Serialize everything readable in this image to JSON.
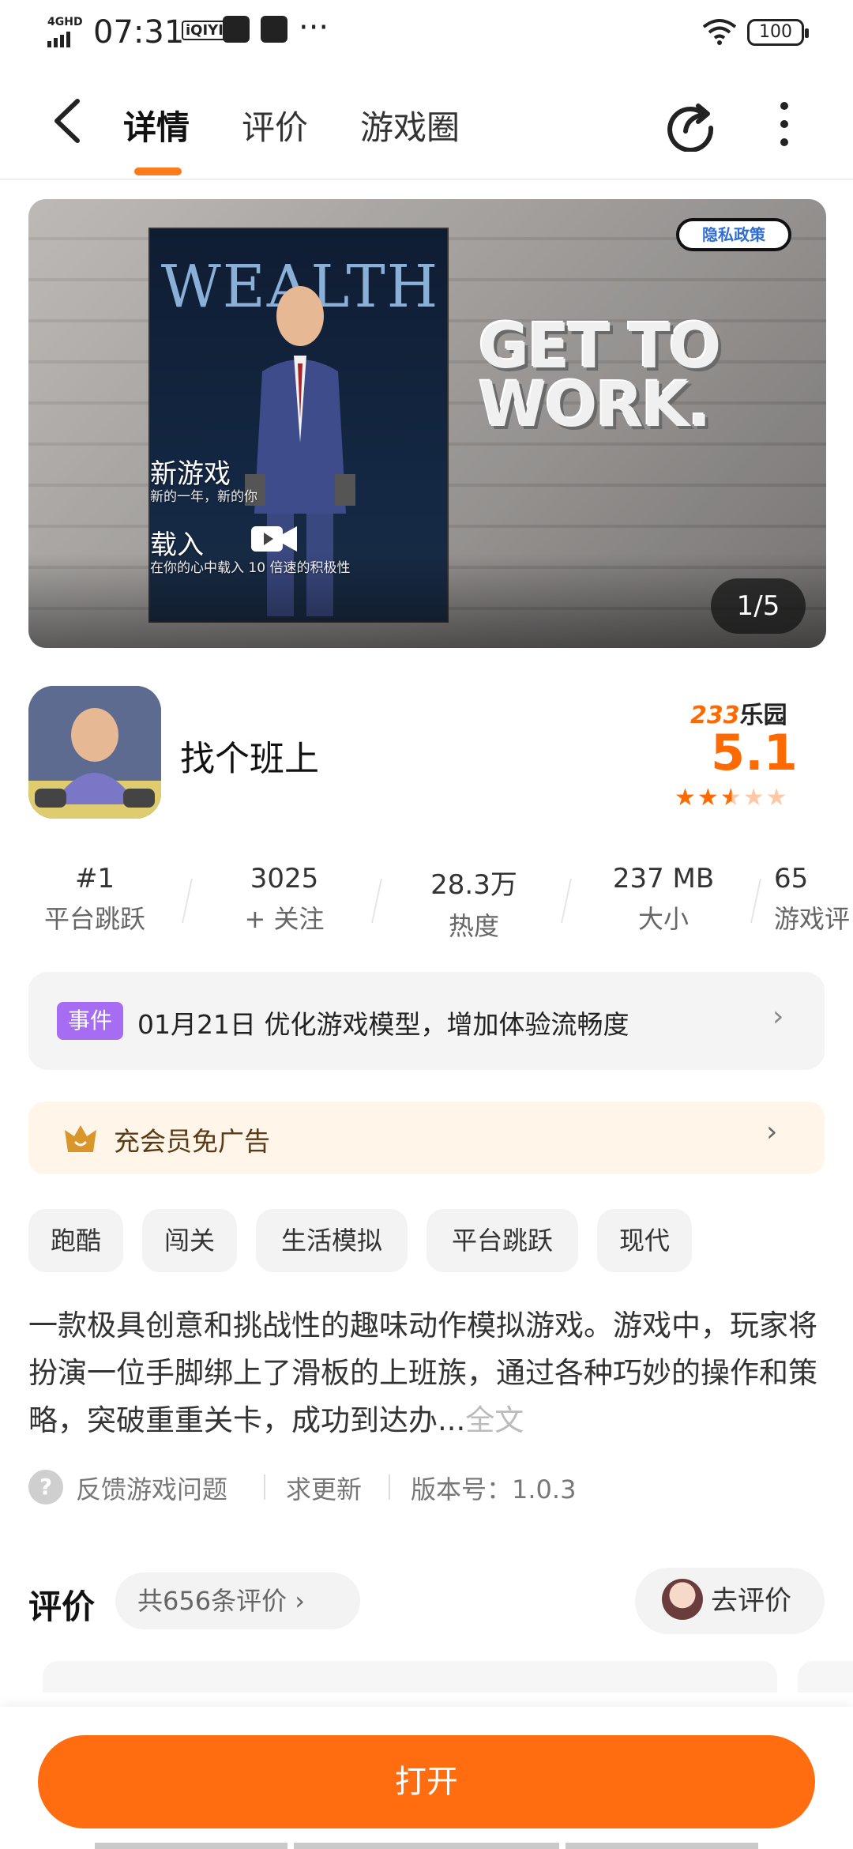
{
  "status_bar": {
    "network": "4GHD",
    "time": "07:31",
    "app_icon_1": "iQIYI",
    "more": "···",
    "battery": "100"
  },
  "header": {
    "tabs": [
      {
        "label": "详情",
        "active": true
      },
      {
        "label": "评价",
        "active": false
      },
      {
        "label": "游戏圈",
        "active": false
      }
    ],
    "accent": "#ff7a1a"
  },
  "banner": {
    "poster_title": "WEALTH",
    "tagline_lines": [
      "GET TO",
      "WORK."
    ],
    "privacy_button": "隐私政策",
    "overlay_new_game_title": "新游戏",
    "overlay_new_game_sub": "新的一年，新的你",
    "overlay_load_title": "载入",
    "overlay_load_sub": "在你的心中载入 10 倍速的积极性",
    "page_indicator": "1/5"
  },
  "app": {
    "name": "找个班上",
    "brand_num": "233",
    "brand_text": "乐园",
    "score": "5.1",
    "stars": 2.5
  },
  "stats": [
    {
      "value": "#1",
      "label": "平台跳跃"
    },
    {
      "value": "3025",
      "label": "+ 关注"
    },
    {
      "value": "28.3万",
      "label": "热度"
    },
    {
      "value": "237 MB",
      "label": "大小"
    },
    {
      "value": "65",
      "label": "游戏评"
    }
  ],
  "event": {
    "badge": "事件",
    "text": "01月21日  优化游戏模型，增加体验流畅度"
  },
  "vip": {
    "text": "充会员免广告"
  },
  "tags": [
    "跑酷",
    "闯关",
    "生活模拟",
    "平台跳跃",
    "现代"
  ],
  "description": {
    "text": "一款极具创意和挑战性的趣味动作模拟游戏。游戏中，玩家将扮演一位手脚绑上了滑板的上班族，通过各种巧妙的操作和策略，突破重重关卡，成功到达办...",
    "more": "全文"
  },
  "feedback": {
    "report": "反馈游戏问题",
    "request_update": "求更新",
    "version": "版本号：1.0.3"
  },
  "reviews": {
    "title": "评价",
    "count": "共656条评价 ›",
    "go_review": "去评价"
  },
  "bottom": {
    "open_button": "打开",
    "button_color": "#ff6d10"
  }
}
